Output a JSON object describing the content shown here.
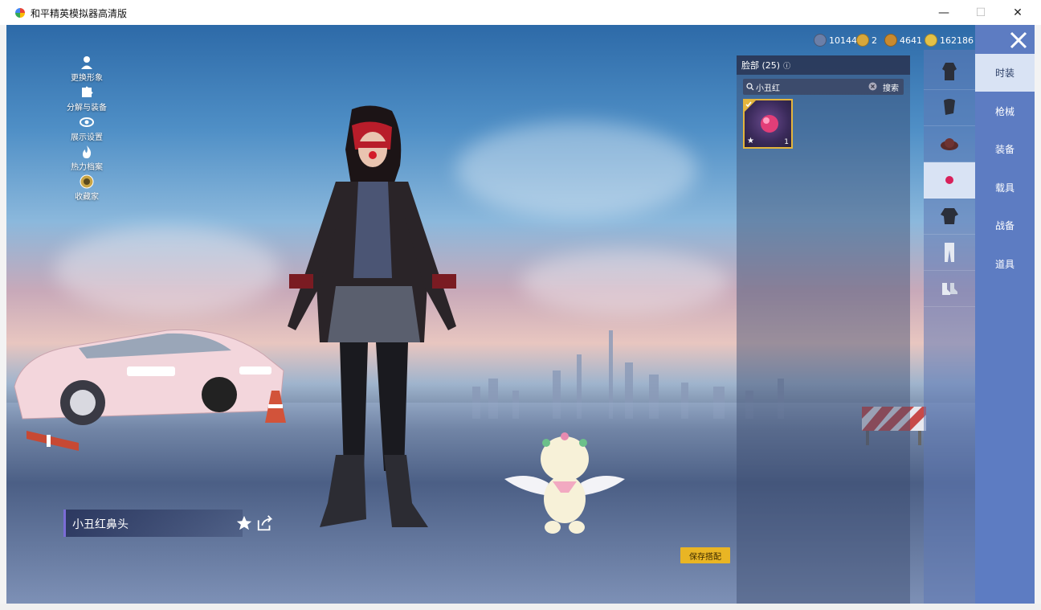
{
  "window": {
    "title": "和平精英模拟器高清版",
    "minimize": "—",
    "maximize": "☐",
    "close": "✕"
  },
  "left_menu": [
    {
      "label": "更换形象",
      "icon": "person-icon"
    },
    {
      "label": "分解与装备",
      "icon": "puzzle-icon"
    },
    {
      "label": "展示设置",
      "icon": "eye-icon"
    },
    {
      "label": "热力档案",
      "icon": "flame-icon"
    },
    {
      "label": "收藏家",
      "icon": "medal-icon"
    }
  ],
  "currencies": [
    {
      "value": "10144",
      "color": "#6b7fa8"
    },
    {
      "value": "2",
      "color": "#d8a73a"
    },
    {
      "value": "4641",
      "color": "#c98a2e"
    },
    {
      "value": "162186",
      "color": "#e3c147"
    }
  ],
  "item_panel": {
    "title": "脸部 (25)",
    "search_value": "小丑红",
    "search_button": "搜索",
    "item_count": "1"
  },
  "categories": [
    {
      "label": "时装",
      "active": true
    },
    {
      "label": "枪械",
      "active": false
    },
    {
      "label": "装备",
      "active": false
    },
    {
      "label": "载具",
      "active": false
    },
    {
      "label": "战备",
      "active": false
    },
    {
      "label": "道具",
      "active": false
    }
  ],
  "sub_icons": [
    {
      "name": "outfit-icon",
      "active": false
    },
    {
      "name": "hair-icon",
      "active": false
    },
    {
      "name": "hat-icon",
      "active": false
    },
    {
      "name": "face-icon",
      "active": true
    },
    {
      "name": "top-icon",
      "active": false
    },
    {
      "name": "pants-icon",
      "active": false
    },
    {
      "name": "shoes-icon",
      "active": false
    }
  ],
  "selected_item_name": "小丑红鼻头",
  "save_button": "保存搭配",
  "colors": {
    "accent": "#e9b524",
    "panel": "#5d7cc2",
    "active_tab": "#d9e3f4"
  }
}
